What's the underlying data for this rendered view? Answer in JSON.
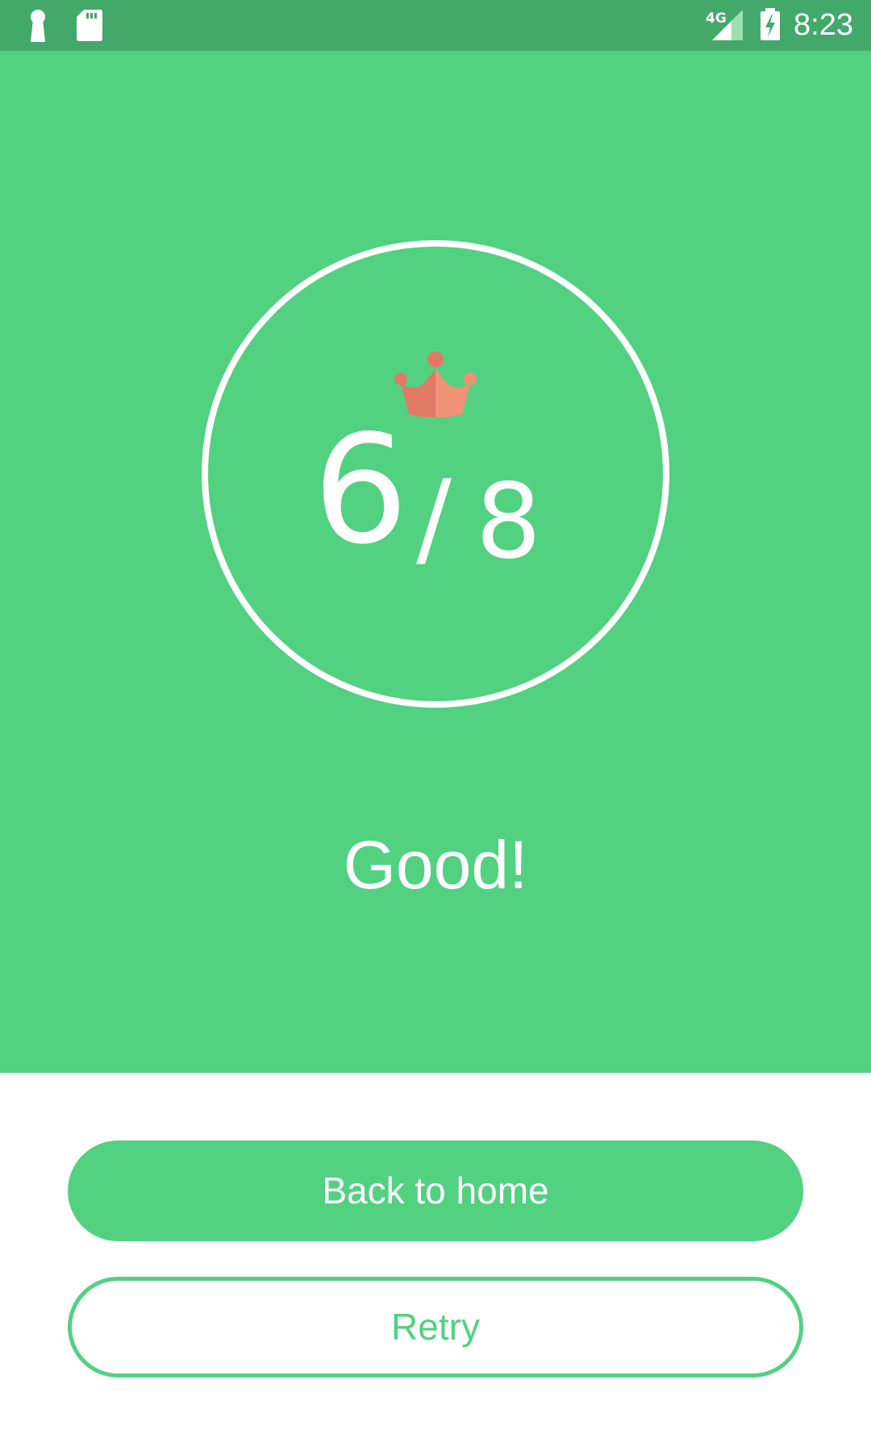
{
  "status_bar": {
    "time": "8:23",
    "network": "4G",
    "icons": [
      "keyhole-icon",
      "sd-card-icon",
      "signal-icon",
      "battery-charging-icon"
    ]
  },
  "colors": {
    "primary": "#52d181",
    "status_bar": "#43a96a",
    "crown_light": "#ef9278",
    "crown_dark": "#e07a66",
    "text_on_primary": "#ffffff",
    "background": "#ffffff"
  },
  "result": {
    "score": "6",
    "separator": "/",
    "total": "8",
    "score_fraction": 0.75,
    "message": "Good!",
    "badge_icon": "crown-icon"
  },
  "actions": {
    "home_label": "Back to home",
    "retry_label": "Retry"
  }
}
